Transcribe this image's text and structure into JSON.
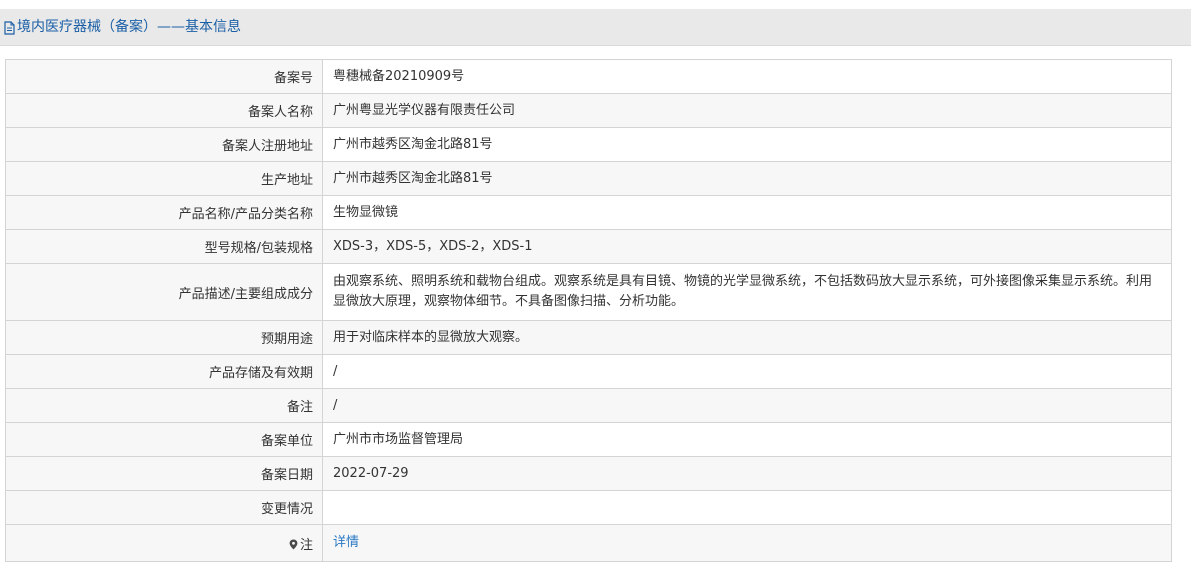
{
  "header": {
    "title": "境内医疗器械（备案）——基本信息",
    "icon": "document-icon",
    "color": "#1a5fa6"
  },
  "fields": {
    "record_no": {
      "label": "备案号",
      "value": "粤穗械备20210909号"
    },
    "registrant_name": {
      "label": "备案人名称",
      "value": "广州粤显光学仪器有限责任公司"
    },
    "registrant_address": {
      "label": "备案人注册地址",
      "value": "广州市越秀区淘金北路81号"
    },
    "production_address": {
      "label": "生产地址",
      "value": "广州市越秀区淘金北路81号"
    },
    "product_name": {
      "label": "产品名称/产品分类名称",
      "value": "生物显微镜"
    },
    "model_spec": {
      "label": "型号规格/包装规格",
      "value": "XDS-3，XDS-5，XDS-2，XDS-1"
    },
    "description": {
      "label": "产品描述/主要组成成分",
      "value": "由观察系统、照明系统和载物台组成。观察系统是具有目镜、物镜的光学显微系统，不包括数码放大显示系统，可外接图像采集显示系统。利用显微放大原理，观察物体细节。不具备图像扫描、分析功能。"
    },
    "intended_use": {
      "label": "预期用途",
      "value": "用于对临床样本的显微放大观察。"
    },
    "storage_validity": {
      "label": "产品存储及有效期",
      "value": "/"
    },
    "remarks": {
      "label": "备注",
      "value": "/"
    },
    "filing_unit": {
      "label": "备案单位",
      "value": "广州市市场监督管理局"
    },
    "filing_date": {
      "label": "备案日期",
      "value": "2022-07-29"
    },
    "change_status": {
      "label": "变更情况",
      "value": ""
    },
    "note": {
      "label": "注",
      "icon": "location-pin-icon",
      "link_text": "详情"
    }
  },
  "colors": {
    "link": "#2a7ac4",
    "header_bg": "#e9e9e9",
    "row_alt_bg": "#f7f7f7",
    "border": "#d4d4d4"
  }
}
